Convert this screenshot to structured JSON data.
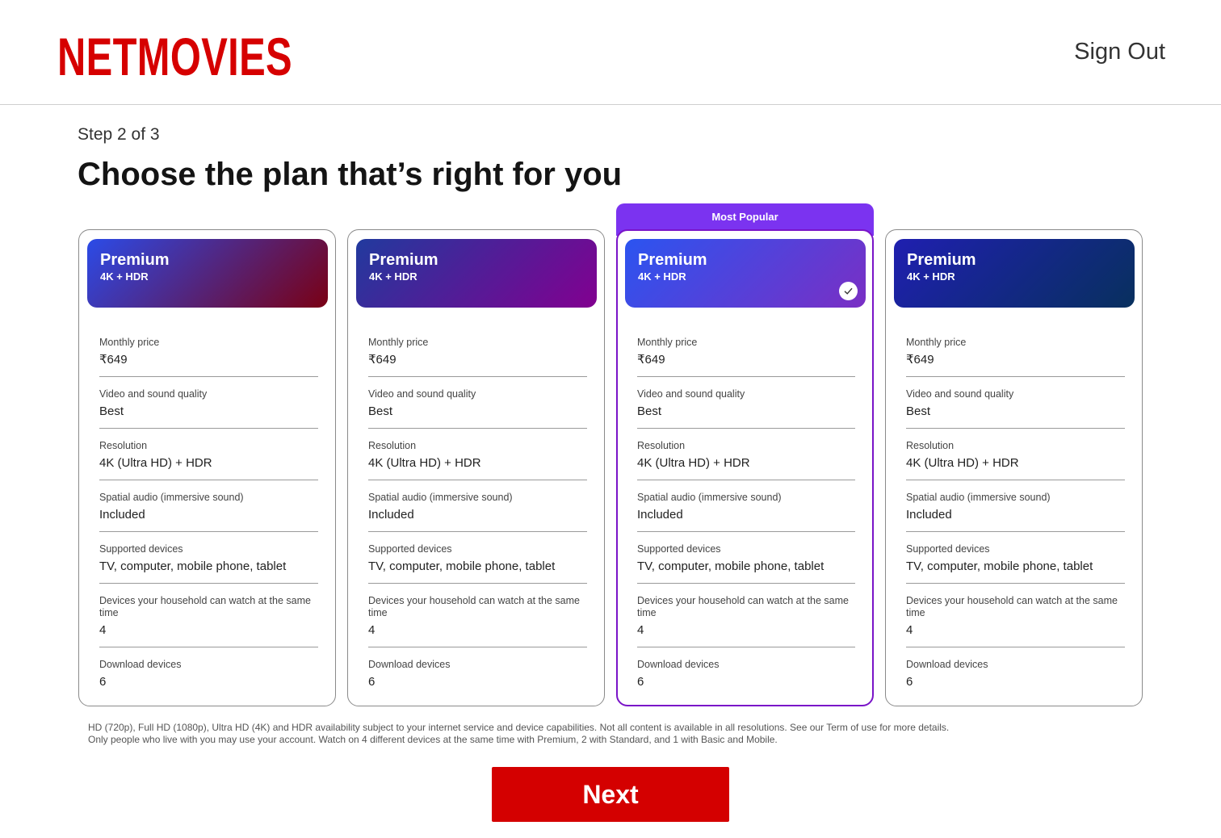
{
  "header": {
    "logo": "NETMOVIES",
    "sign_out": "Sign Out"
  },
  "step": "Step 2 of 3",
  "title": "Choose the plan that’s right for you",
  "popular_label": "Most Popular",
  "plans": [
    {
      "name": "Premium",
      "quality": "4K + HDR",
      "gradient": [
        "#2b4be8",
        "#7a0014"
      ],
      "rows": [
        {
          "label": "Monthly price",
          "value": "₹649"
        },
        {
          "label": "Video and sound quality",
          "value": "Best"
        },
        {
          "label": "Resolution",
          "value": "4K (Ultra HD) + HDR"
        },
        {
          "label": "Spatial audio (immersive sound)",
          "value": "Included"
        },
        {
          "label": "Supported devices",
          "value": "TV, computer, mobile phone, tablet"
        },
        {
          "label": "Devices your household can watch at the same time",
          "value": "4"
        },
        {
          "label": "Download devices",
          "value": "6"
        }
      ]
    },
    {
      "name": "Premium",
      "quality": "4K + HDR",
      "gradient": [
        "#213a9e",
        "#820090"
      ],
      "rows": [
        {
          "label": "Monthly price",
          "value": "₹649"
        },
        {
          "label": "Video and sound quality",
          "value": "Best"
        },
        {
          "label": "Resolution",
          "value": "4K (Ultra HD) + HDR"
        },
        {
          "label": "Spatial audio (immersive sound)",
          "value": "Included"
        },
        {
          "label": "Supported devices",
          "value": "TV, computer, mobile phone, tablet"
        },
        {
          "label": "Devices your household can watch at the same time",
          "value": "4"
        },
        {
          "label": "Download devices",
          "value": "6"
        }
      ]
    },
    {
      "name": "Premium",
      "quality": "4K + HDR",
      "gradient": [
        "#2b54f0",
        "#7a2fc4"
      ],
      "selected": true,
      "rows": [
        {
          "label": "Monthly price",
          "value": "₹649"
        },
        {
          "label": "Video and sound quality",
          "value": "Best"
        },
        {
          "label": "Resolution",
          "value": "4K (Ultra HD) + HDR"
        },
        {
          "label": "Spatial audio (immersive sound)",
          "value": "Included"
        },
        {
          "label": "Supported devices",
          "value": "TV, computer, mobile phone, tablet"
        },
        {
          "label": "Devices your household can watch at the same time",
          "value": "4"
        },
        {
          "label": "Download devices",
          "value": "6"
        }
      ]
    },
    {
      "name": "Premium",
      "quality": "4K + HDR",
      "gradient": [
        "#1f1fb0",
        "#08305e"
      ],
      "rows": [
        {
          "label": "Monthly price",
          "value": "₹649"
        },
        {
          "label": "Video and sound quality",
          "value": "Best"
        },
        {
          "label": "Resolution",
          "value": "4K (Ultra HD) + HDR"
        },
        {
          "label": "Spatial audio (immersive sound)",
          "value": "Included"
        },
        {
          "label": "Supported devices",
          "value": "TV, computer, mobile phone, tablet"
        },
        {
          "label": "Devices your household can watch at the same time",
          "value": "4"
        },
        {
          "label": "Download devices",
          "value": "6"
        }
      ]
    }
  ],
  "footnote": {
    "line1": "HD (720p), Full HD (1080p), Ultra HD (4K) and HDR availability subject to your internet service and device capabilities. Not all content is available in all resolutions. See our Term of use for more details.",
    "line2": "Only people who live with you may use your account. Watch on 4 different devices at the same time with Premium, 2 with Standard, and 1 with Basic and Mobile."
  },
  "next_label": "Next",
  "colors": {
    "brand": "#d60000",
    "selected_border": "#7a14c8",
    "popular_tab": "#7b33f0"
  }
}
